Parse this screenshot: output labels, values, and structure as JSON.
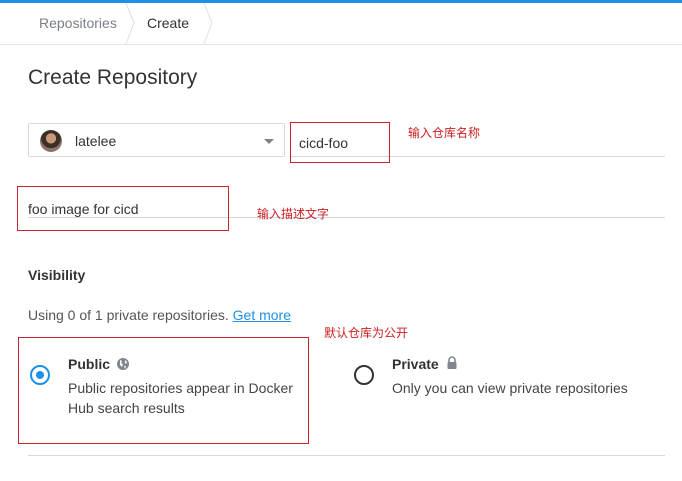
{
  "breadcrumb": {
    "items": [
      "Repositories",
      "Create"
    ]
  },
  "page": {
    "title": "Create Repository"
  },
  "form": {
    "owner": {
      "name": "latelee",
      "avatar_icon": "user-avatar-icon"
    },
    "repo_name": {
      "value": "cicd-foo"
    },
    "description": {
      "value": "foo image for cicd"
    }
  },
  "annotations": {
    "name": "输入仓库名称",
    "description": "输入描述文字",
    "visibility": "默认仓库为公开"
  },
  "visibility": {
    "title": "Visibility",
    "usage_text": "Using 0 of 1 private repositories.",
    "get_more": "Get more",
    "public": {
      "label": "Public",
      "description": "Public repositories appear in Docker Hub search results",
      "icon": "globe-icon",
      "selected": true
    },
    "private": {
      "label": "Private",
      "description": "Only you can view private repositories",
      "icon": "lock-icon",
      "selected": false
    }
  },
  "colors": {
    "accent": "#1d91e8",
    "annotation": "#cc1f1f"
  }
}
